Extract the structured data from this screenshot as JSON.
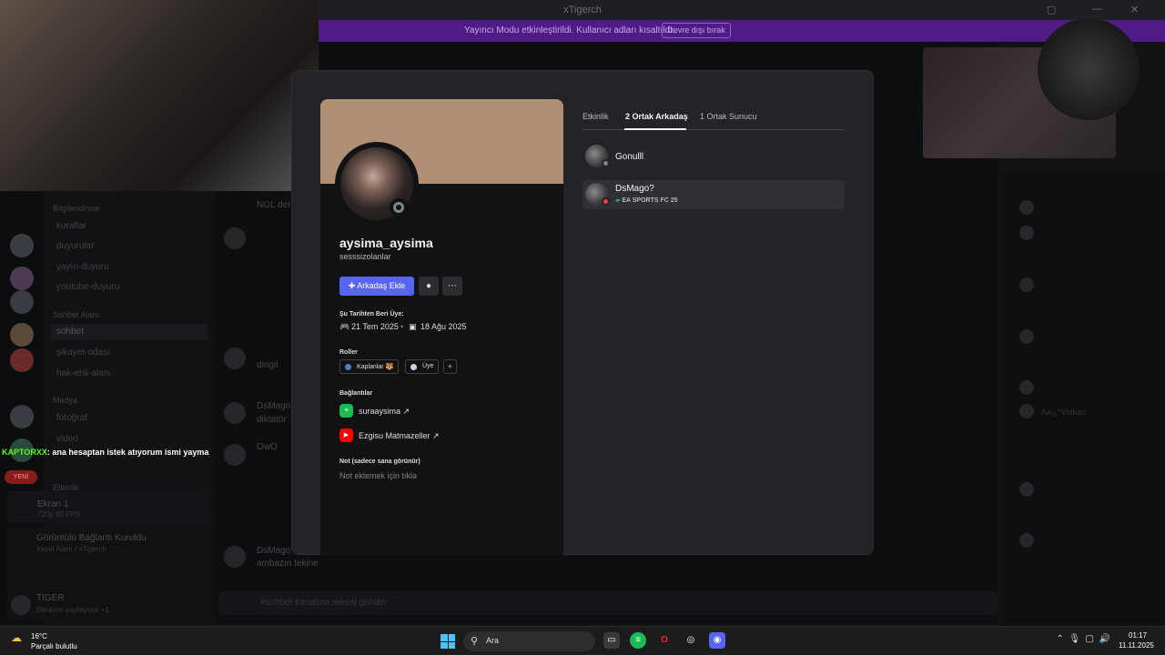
{
  "window": {
    "title": "xTigerch"
  },
  "banner": {
    "text": "Yayıncı Modu etkinleştirildi. Kullanıcı adları kısaltıldı.",
    "button": "Devre dışı bırak"
  },
  "channels": {
    "cat_info": "Bilgilendirme",
    "kurallar": "kurallar",
    "duyurular": "duyurular",
    "yayin_duyuru": "yayın-duyuru",
    "youtube_duyuru": "youtube-duyuru",
    "cat_chat": "Sohbet Alanı",
    "sohbet": "sohbet",
    "sikayet": "şikayet-odası",
    "hak_ehli": "hak-ehli-alanı",
    "cat_media": "Medya",
    "fotograf": "fotoğraf",
    "video": "video",
    "cat_events": "Etkinlik"
  },
  "chat": {
    "m1": "NGL der",
    "m2": "dingil",
    "m3_author": "DsMago",
    "m3": "diktatör",
    "m4_author": "OwO",
    "m5_author": "DsMago",
    "m5": "ambazın tekine",
    "composer_placeholder": "#sohbet kanalına mesaj gönder"
  },
  "stream": {
    "title": "Ekran 1",
    "sub": "720p 60 FPS"
  },
  "voice": {
    "title": "Görüntülü Bağlantı Kuruldu",
    "sub": "Yayın Alanı / xTigerch"
  },
  "user": {
    "name": "TIGER",
    "status": "Ekranını paylaşıyor +1"
  },
  "overlay": {
    "user": "KAPTORXX",
    "text": ": ana hesaptan istek atıyorum ismi yayma",
    "new": "YENİ"
  },
  "profile": {
    "display_name": "aysima_aysima",
    "username": "sesssizolanlar",
    "add_friend": "Arkadaş Ekle",
    "member_since_label": "Şu Tarihten Beri Üye:",
    "discord_since": "21 Tem 2025",
    "server_since": "18 Ağu 2025",
    "roles_label": "Roller",
    "roles": [
      {
        "name": "Kaplanlar 🐯",
        "color": "#4f7fb8"
      },
      {
        "name": "Üye",
        "color": "#c9d4f0"
      }
    ],
    "connections_label": "Bağlantılar",
    "connections": [
      {
        "name": "suraaysima ↗",
        "service": "spotify"
      },
      {
        "name": "Ezgisu Matmazeller ↗",
        "service": "youtube"
      }
    ],
    "note_label": "Not (sadece sana görünür)",
    "note_placeholder": "Not eklemek için tıkla"
  },
  "tabs": [
    "Etkinlik",
    "2 Ortak Arkadaş",
    "1 Ortak Sunucu"
  ],
  "mutual_friends": [
    {
      "name": "Gonulll",
      "status_color": "#80848e"
    },
    {
      "name": "DsMago?",
      "activity": "EA SPORTS FC 25",
      "status_color": "#f23f43"
    }
  ],
  "members_visible": [
    "Aw¿^Volkan"
  ],
  "weather": {
    "temp": "16°C",
    "desc": "Parçalı bulutlu"
  },
  "taskbar": {
    "search": "Ara"
  },
  "clock": {
    "time": "01:17",
    "date": "11.11.2025"
  },
  "colors": {
    "blurple": "#5865f2",
    "banner": "#b08f74",
    "spotify": "#1db954",
    "youtube": "#ff0000"
  }
}
